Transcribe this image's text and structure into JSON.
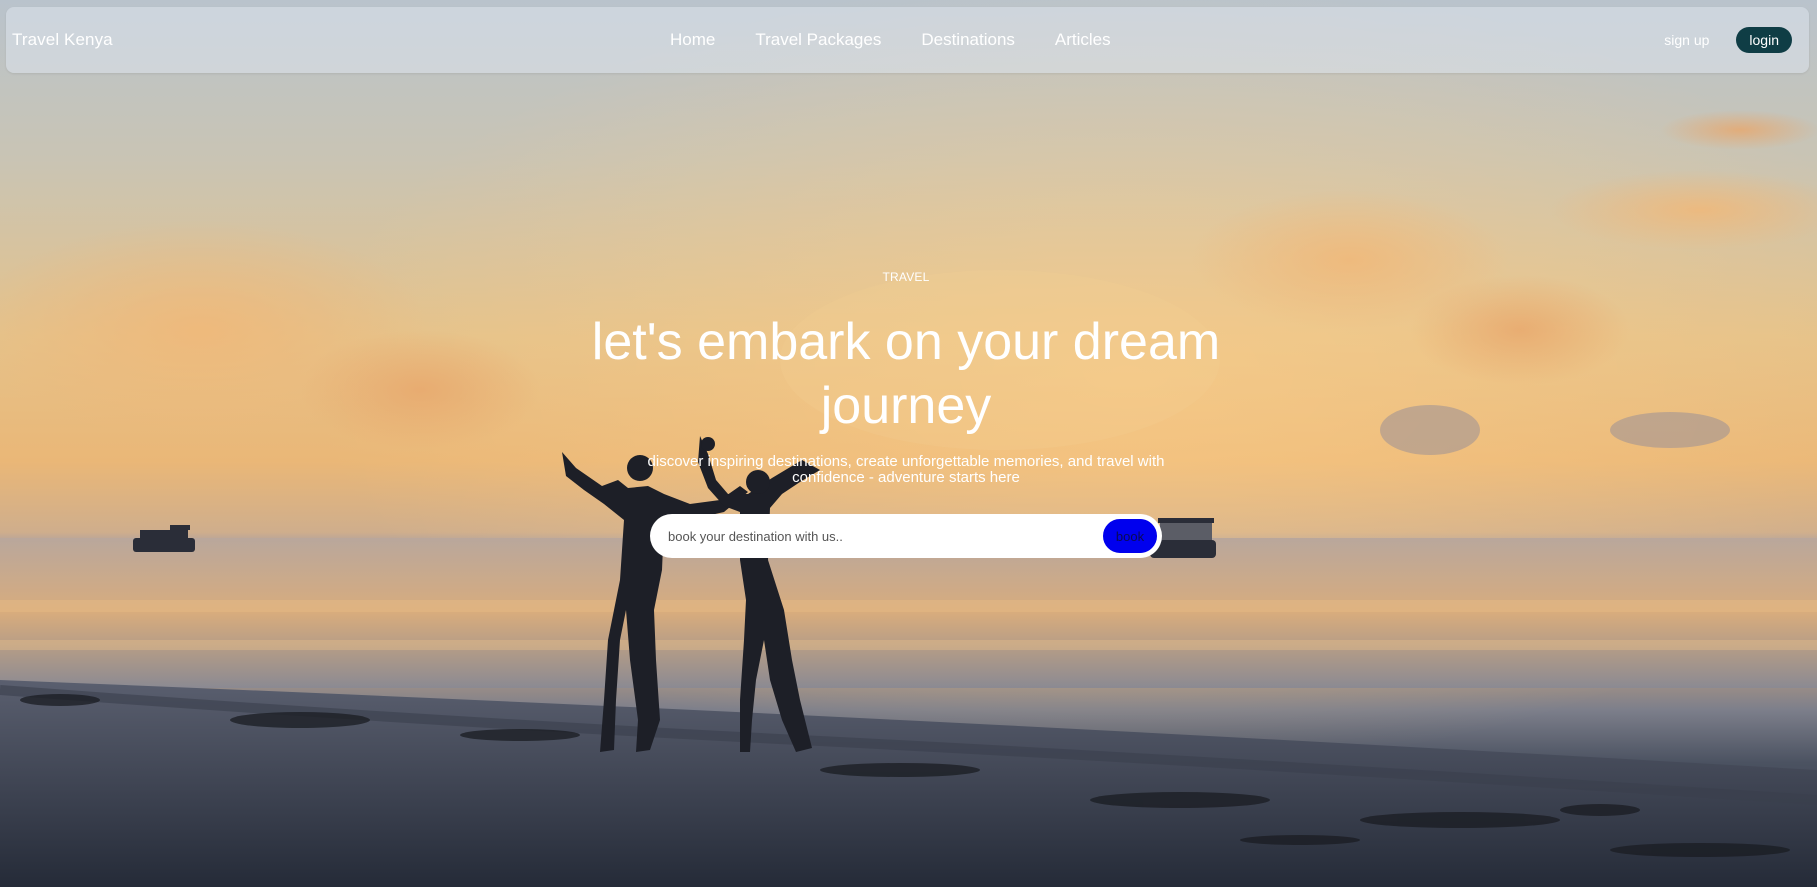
{
  "navbar": {
    "brand": "Travel Kenya",
    "links": [
      "Home",
      "Travel Packages",
      "Destinations",
      "Articles"
    ],
    "sign_up": "sign up",
    "login": "login"
  },
  "hero": {
    "eyebrow": "TRAVEL",
    "headline": "let's embark on your dream journey",
    "subtext": "discover inspiring destinations, create unforgettable memories, and travel with confidence - adventure starts here",
    "search": {
      "placeholder": "book your destination with us..",
      "value": "",
      "button_label": "book"
    },
    "image_description_icon": "beach-sunset-photo"
  },
  "colors": {
    "login_bg": "#0f3d45",
    "book_button": "#0000ee",
    "text": "#ffffff"
  }
}
